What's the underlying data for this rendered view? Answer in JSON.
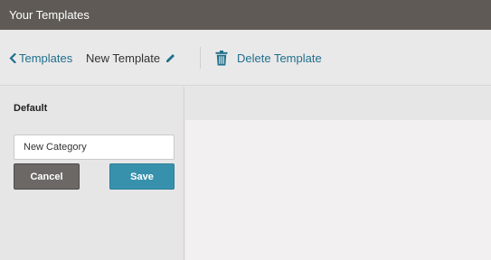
{
  "window": {
    "title": "Your Templates"
  },
  "toolbar": {
    "back_label": "Templates",
    "template_name": "New Template",
    "delete_label": "Delete Template"
  },
  "sidebar": {
    "section_label": "Default",
    "category_input_value": "New Category",
    "cancel_label": "Cancel",
    "save_label": "Save"
  },
  "icons": {
    "back": "chevron-left-icon",
    "edit": "pencil-icon",
    "delete": "trash-icon"
  },
  "colors": {
    "titlebar": "#5f5a55",
    "link": "#1f6f8b",
    "save_button": "#3791ad",
    "cancel_button": "#6b6865"
  }
}
